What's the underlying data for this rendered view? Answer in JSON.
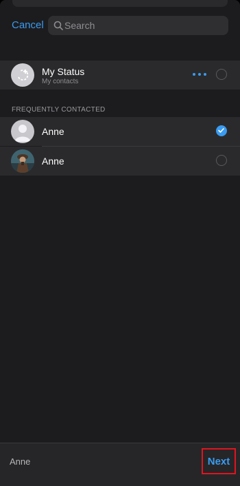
{
  "header": {
    "cancel_label": "Cancel",
    "search_placeholder": "Search"
  },
  "my_status": {
    "title": "My Status",
    "subtitle": "My contacts",
    "selected": false
  },
  "section": {
    "title": "FREQUENTLY CONTACTED"
  },
  "contacts": [
    {
      "name": "Anne",
      "avatar": "default-person-avatar",
      "selected": true
    },
    {
      "name": "Anne",
      "avatar": "photo-avatar",
      "selected": false
    }
  ],
  "footer": {
    "selected_names": "Anne",
    "next_label": "Next"
  },
  "colors": {
    "accent": "#3a9bf0",
    "highlight_box": "#e0141e"
  }
}
